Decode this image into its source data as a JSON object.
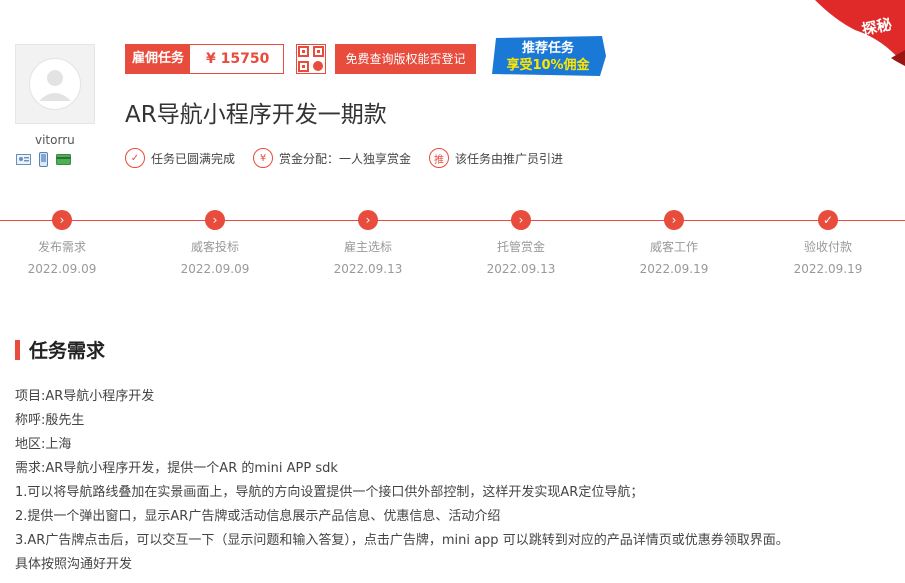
{
  "user": {
    "name": "vitorru",
    "verify_icons": [
      "id-card-icon",
      "phone-icon",
      "bank-card-icon"
    ]
  },
  "task": {
    "type_label": "雇佣任务",
    "price": "¥ 15750",
    "copyright_button": "免费查询版权能否登记",
    "promo_line1": "推荐任务",
    "promo_line2": "享受10%佣金",
    "corner_label": "探秘",
    "title": "AR导航小程序开发一期款",
    "features": [
      {
        "icon": "check-circle-icon",
        "text": "任务已圆满完成"
      },
      {
        "icon": "yen-circle-icon",
        "text": "赏金分配：一人独享赏金"
      },
      {
        "icon": "recommend-circle-icon",
        "icon_text": "推",
        "text": "该任务由推广员引进"
      }
    ]
  },
  "timeline": [
    {
      "name": "发布需求",
      "date": "2022.09.09",
      "icon": "arrow-right-icon"
    },
    {
      "name": "威客投标",
      "date": "2022.09.09",
      "icon": "arrow-right-icon"
    },
    {
      "name": "雇主选标",
      "date": "2022.09.13",
      "icon": "arrow-right-icon"
    },
    {
      "name": "托管赏金",
      "date": "2022.09.13",
      "icon": "arrow-right-icon"
    },
    {
      "name": "威客工作",
      "date": "2022.09.19",
      "icon": "arrow-right-icon"
    },
    {
      "name": "验收付款",
      "date": "2022.09.19",
      "icon": "check-icon"
    }
  ],
  "requirements": {
    "heading": "任务需求",
    "lines": [
      "项目:AR导航小程序开发",
      "称呼:殷先生",
      "地区:上海",
      "需求:AR导航小程序开发，提供一个AR 的mini APP sdk",
      "1.可以将导航路线叠加在实景画面上，导航的方向设置提供一个接口供外部控制，这样开发实现AR定位导航；",
      "2.提供一个弹出窗口，显示AR广告牌或活动信息展示产品信息、优惠信息、活动介绍",
      "3.AR广告牌点击后，可以交互一下（显示问题和输入答复），点击广告牌，mini app 可以跳转到对应的产品详情页或优惠券领取界面。",
      "具体按照沟通好开发"
    ]
  },
  "colors": {
    "accent": "#e84c3d",
    "promo_blue": "#1a78d6",
    "promo_yellow": "#ffe600"
  }
}
